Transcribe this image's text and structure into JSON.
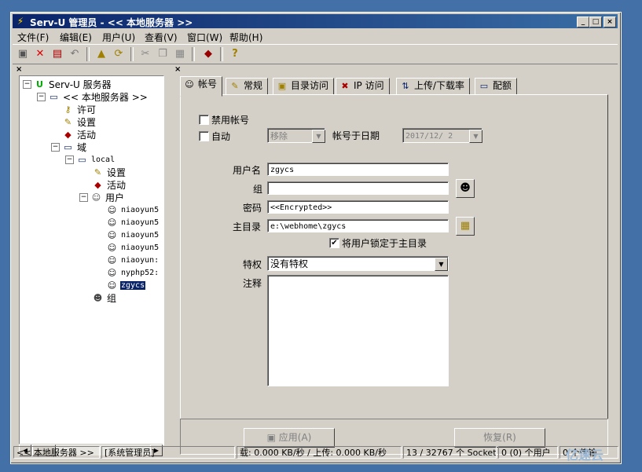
{
  "window": {
    "title": "Serv-U 管理员 - << 本地服务器 >>",
    "minimize": "_",
    "maximize": "□",
    "close": "×"
  },
  "menu": [
    "文件(F)",
    "编辑(E)",
    "用户(U)",
    "查看(V)",
    "窗口(W)",
    "帮助(H)"
  ],
  "toolbar": {
    "icons": [
      "save-icon",
      "delete-icon",
      "copy-config-icon",
      "undo-icon",
      "folder-up-icon",
      "refresh-icon",
      "cut-icon",
      "copy-icon",
      "paste-icon",
      "book-icon",
      "help-icon"
    ]
  },
  "panes": {
    "left_close": "×",
    "right_close": "×"
  },
  "tree": {
    "root": "Serv-U 服务器",
    "server": "<< 本地服务器 >>",
    "license": "许可",
    "settings": "设置",
    "activity": "活动",
    "domains": "域",
    "domain_name": "local",
    "domain_settings": "设置",
    "domain_activity": "活动",
    "users_label": "用户",
    "users": [
      "niaoyun5",
      "niaoyun5",
      "niaoyun5",
      "niaoyun5",
      "niaoyun:",
      "nyphp52:",
      "zgycs"
    ],
    "groups": "组",
    "scroll_left": "◀",
    "scroll_right": "▶"
  },
  "tabs": [
    "帐号",
    "常规",
    "目录访问",
    "IP 访问",
    "上传/下载率",
    "配额"
  ],
  "form": {
    "disable_account_label": "禁用帐号",
    "auto_label": "自动",
    "auto_action": "移除",
    "expire_label": "帐号于日期",
    "expire_date": "2017/12/ 2",
    "username_label": "用户名",
    "username": "zgycs",
    "group_label": "组",
    "group": "",
    "password_label": "密码",
    "password": "<<Encrypted>>",
    "home_label": "主目录",
    "home": "e:\\webhome\\zgycs",
    "lock_home_label": "将用户锁定于主目录",
    "lock_home_checked": "✔",
    "privilege_label": "特权",
    "privilege": "没有特权",
    "notes_label": "注释",
    "dd_arrow": "▼"
  },
  "buttons": {
    "apply": "应用(A)",
    "restore": "恢复(R)"
  },
  "status": {
    "server": "<< 本地服务器 >>",
    "role": "[系统管理员]",
    "speed": "载: 0.000 KB/秒 / 上传: 0.000 KB/秒",
    "sockets": "13 / 32767 个 Socket",
    "users": "0 (0) 个用户",
    "transfers": "0 个传输"
  },
  "watermark": "亿速云"
}
